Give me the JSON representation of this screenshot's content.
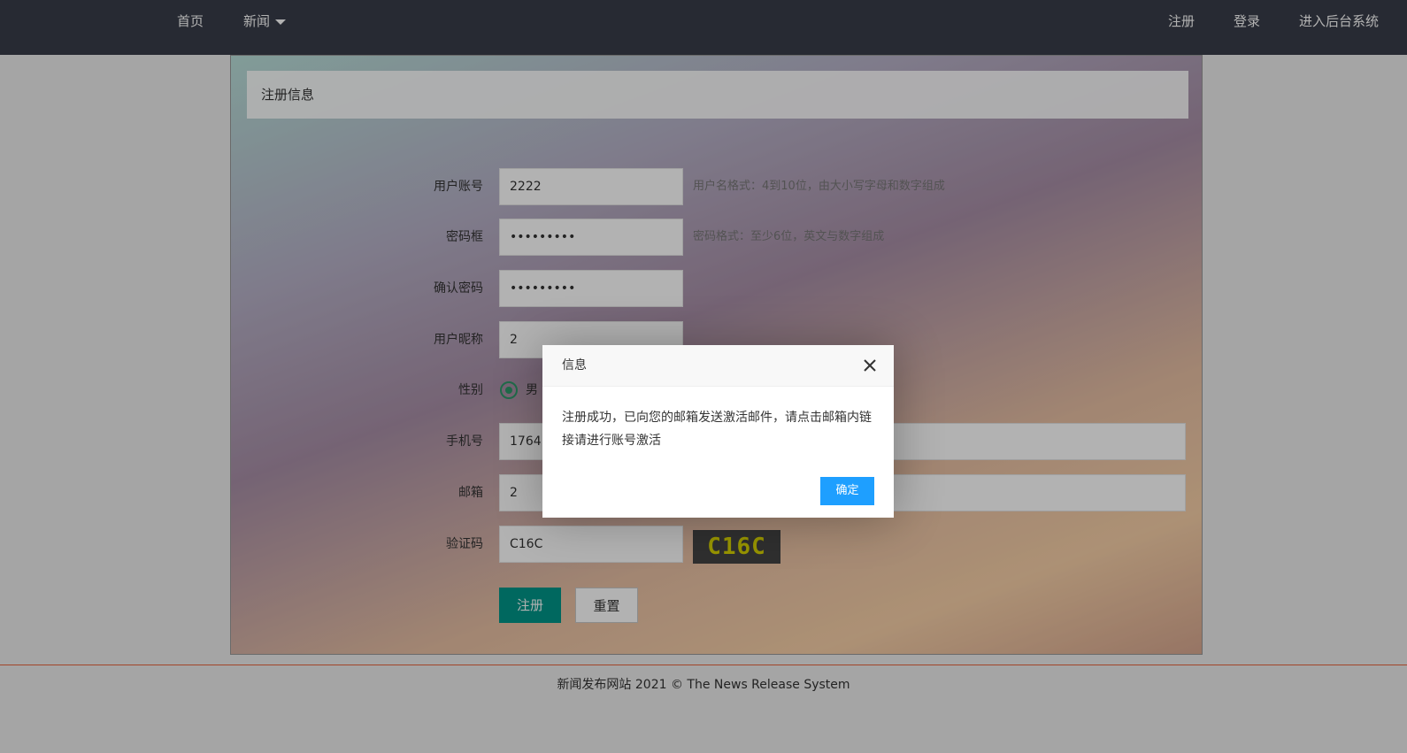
{
  "nav": {
    "home": "首页",
    "news": "新闻",
    "register": "注册",
    "login": "登录",
    "admin": "进入后台系统"
  },
  "card": {
    "header": "注册信息"
  },
  "form": {
    "username": {
      "label": "用户账号",
      "value": "2222",
      "tip": "用户名格式：4到10位，由大小写字母和数字组成"
    },
    "password": {
      "label": "密码框",
      "value": "•••••••••",
      "tip": "密码格式：至少6位，英文与数字组成"
    },
    "confirm": {
      "label": "确认密码",
      "value": "•••••••••"
    },
    "nickname": {
      "label": "用户昵称",
      "value": "2"
    },
    "gender": {
      "label": "性别",
      "option_male": "男"
    },
    "phone": {
      "label": "手机号",
      "value": "17641"
    },
    "email": {
      "label": "邮箱",
      "value": "2"
    },
    "captcha": {
      "label": "验证码",
      "value": "C16C",
      "image_text": "C16C"
    },
    "submit_label": "注册",
    "reset_label": "重置"
  },
  "footer": {
    "text": "新闻发布网站 2021 © The News Release System"
  },
  "dialog": {
    "title": "信息",
    "message": "注册成功，已向您的邮箱发送激活邮件，请点击邮箱内链接请进行账号激活",
    "ok_label": "确定"
  },
  "colors": {
    "nav_bg": "#393d49",
    "primary_button": "#009688",
    "dialog_button": "#1e9fff",
    "footer_line": "#e8643c"
  }
}
